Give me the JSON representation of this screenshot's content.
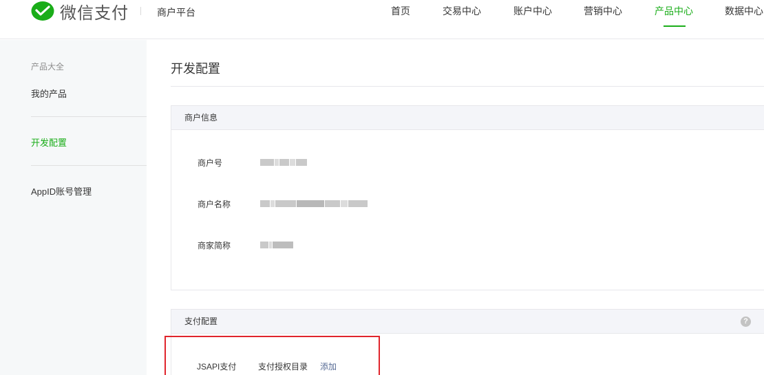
{
  "header": {
    "brand": "微信支付",
    "platform": "商户平台",
    "nav": [
      "首页",
      "交易中心",
      "账户中心",
      "营销中心",
      "产品中心",
      "数据中心"
    ],
    "active_nav": "产品中心",
    "accent_color": "#1aad19"
  },
  "sidebar": {
    "section_title": "产品大全",
    "items": [
      "我的产品",
      "开发配置",
      "AppID账号管理"
    ],
    "active_item": "开发配置"
  },
  "main": {
    "page_title": "开发配置",
    "merchant_panel": {
      "title": "商户信息",
      "fields": [
        {
          "label": "商户号",
          "value": "(blurred)"
        },
        {
          "label": "商户名称",
          "value": "(blurred)"
        },
        {
          "label": "商家简称",
          "value": "(blurred)"
        }
      ]
    },
    "pay_panel": {
      "title": "支付配置",
      "help_icon": "help-icon",
      "row": {
        "type_label": "JSAPI支付",
        "field_label": "支付授权目录",
        "action_link": "添加"
      }
    }
  }
}
